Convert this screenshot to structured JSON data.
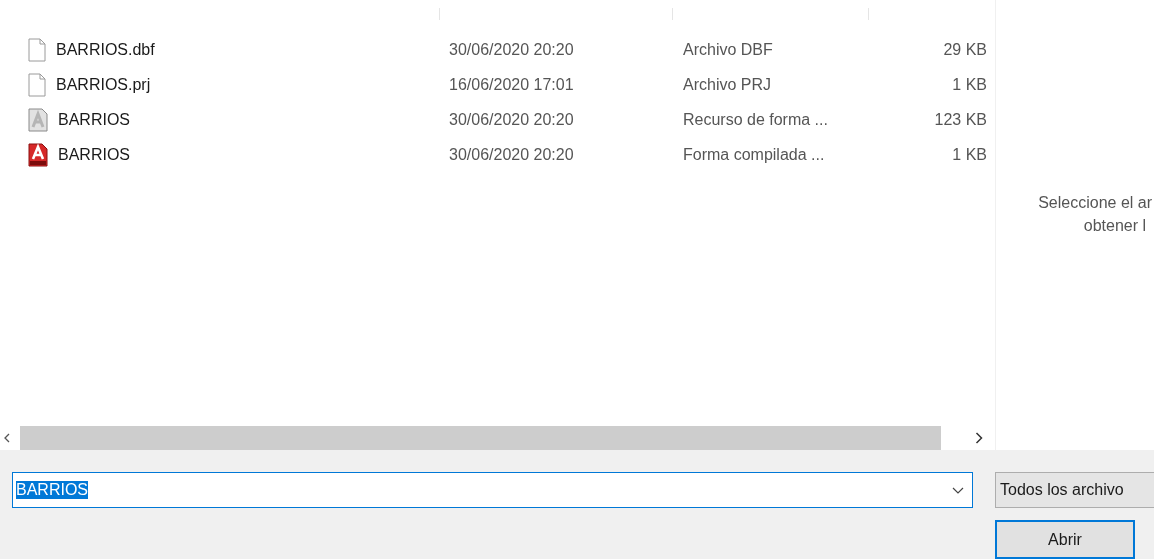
{
  "files": [
    {
      "kind": "blank",
      "name": "BARRIOS.dbf",
      "modified": "30/06/2020 20:20",
      "type": "Archivo DBF",
      "size": "29 KB"
    },
    {
      "kind": "blank",
      "name": "BARRIOS.prj",
      "modified": "16/06/2020 17:01",
      "type": "Archivo PRJ",
      "size": "1 KB"
    },
    {
      "kind": "shape-gray",
      "name": "BARRIOS",
      "modified": "30/06/2020 20:20",
      "type": "Recurso de forma ...",
      "size": "123 KB"
    },
    {
      "kind": "shape-red",
      "name": "BARRIOS",
      "modified": "30/06/2020 20:20",
      "type": "Forma compilada ...",
      "size": "1 KB"
    }
  ],
  "preview": {
    "lines": [
      "Seleccione el ar",
      "obtener l"
    ]
  },
  "file_name": {
    "value": "BARRIOS"
  },
  "file_type": {
    "value": "Todos los archivo"
  },
  "buttons": [
    "Abrir"
  ]
}
